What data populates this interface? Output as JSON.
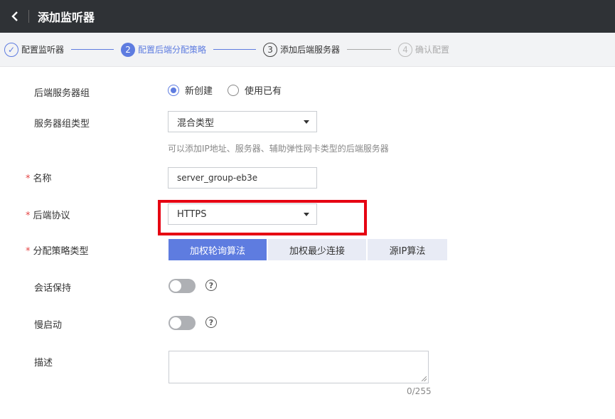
{
  "header": {
    "title": "添加监听器"
  },
  "steps": [
    {
      "num": "✓",
      "label": "配置监听器",
      "state": "done"
    },
    {
      "num": "2",
      "label": "配置后端分配策略",
      "state": "active"
    },
    {
      "num": "3",
      "label": "添加后端服务器",
      "state": "todo"
    },
    {
      "num": "4",
      "label": "确认配置",
      "state": "grey"
    }
  ],
  "form": {
    "server_group": {
      "label": "后端服务器组",
      "option_new": "新创建",
      "option_existing": "使用已有",
      "selected": "new"
    },
    "group_type": {
      "label": "服务器组类型",
      "value": "混合类型",
      "hint": "可以添加IP地址、服务器、辅助弹性网卡类型的后端服务器"
    },
    "name": {
      "label": "名称",
      "value": "server_group-eb3e",
      "required": true
    },
    "protocol": {
      "label": "后端协议",
      "value": "HTTPS",
      "required": true
    },
    "algorithm": {
      "label": "分配策略类型",
      "required": true,
      "options": [
        "加权轮询算法",
        "加权最少连接",
        "源IP算法"
      ],
      "selected": 0
    },
    "sticky": {
      "label": "会话保持",
      "enabled": false,
      "help": "?"
    },
    "slow_start": {
      "label": "慢启动",
      "enabled": false,
      "help": "?"
    },
    "description": {
      "label": "描述",
      "value": "",
      "counter": "0/255"
    }
  },
  "colors": {
    "accent": "#5e7ce0",
    "highlight": "#e60012",
    "topbar": "#2f3236"
  }
}
